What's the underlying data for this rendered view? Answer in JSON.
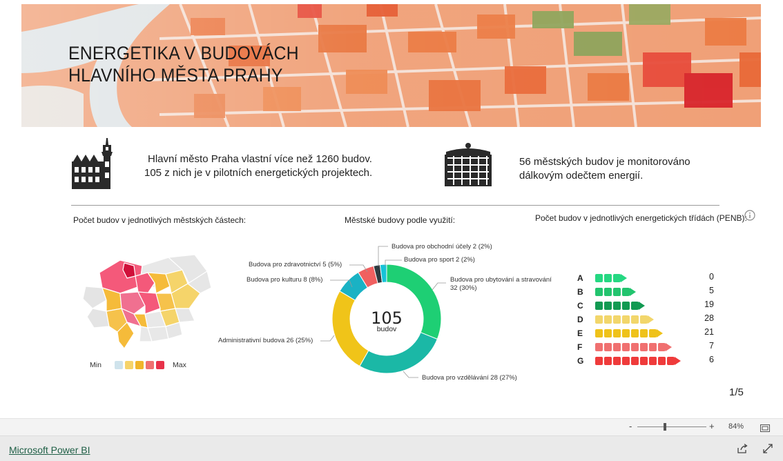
{
  "header": {
    "title_line1": "ENERGETIKA V BUDOVÁCH",
    "title_line2": "HLAVNÍHO MĚSTA PRAHY"
  },
  "info": {
    "left_line1": "Hlavní město Praha vlastní více než 1260 budov.",
    "left_line2": "105 z nich je v pilotních energetických projektech.",
    "right_line1": "56 městských budov je monitorováno",
    "right_line2": "dálkovým odečtem energií."
  },
  "sections": {
    "districts_label": "Počet budov v jednotlivých městských částech:",
    "usage_label": "Městské budovy podle využití:",
    "classes_label": "Počet budov v jednotlivých energetických třídách (PENB):"
  },
  "map_legend": {
    "min": "Min",
    "max": "Max",
    "colors": [
      "#cfe3ec",
      "#f6d36a",
      "#f0b52a",
      "#f07070",
      "#e8324a"
    ]
  },
  "donut": {
    "total": "105",
    "unit": "budov",
    "labels": {
      "sport": "Budova pro sport 2 (2%)",
      "obchod": "Budova pro obchodní účely 2 (2%)",
      "zdrav": "Budova pro zdravotnictví 5 (5%)",
      "kultura": "Budova pro kulturu 8 (8%)",
      "admin": "Administrativní budova 26 (25%)",
      "vzdel": "Budova pro vzdělávání 28 (27%)",
      "ubyt1": "Budova pro ubytování a stravování",
      "ubyt2": "32 (30%)"
    }
  },
  "chart_data": {
    "type": "pie",
    "title": "Městské budovy podle využití:",
    "center_label": "105 budov",
    "slices": [
      {
        "label": "Budova pro ubytování a stravování",
        "value": 32,
        "percent": 30,
        "color": "#1ecf74"
      },
      {
        "label": "Budova pro vzdělávání",
        "value": 28,
        "percent": 27,
        "color": "#1bb8a6"
      },
      {
        "label": "Administrativní budova",
        "value": 26,
        "percent": 25,
        "color": "#f0c419"
      },
      {
        "label": "Budova pro kulturu",
        "value": 8,
        "percent": 8,
        "color": "#1ab2c4"
      },
      {
        "label": "Budova pro zdravotnictví",
        "value": 5,
        "percent": 5,
        "color": "#f06060"
      },
      {
        "label": "Budova pro obchodní účely",
        "value": 2,
        "percent": 2,
        "color": "#2f3b40"
      },
      {
        "label": "Budova pro sport",
        "value": 2,
        "percent": 2,
        "color": "#17c3d8"
      }
    ]
  },
  "energy_classes": [
    {
      "letter": "A",
      "count": "0",
      "blocks": 3,
      "color": "#25d882"
    },
    {
      "letter": "B",
      "count": "5",
      "blocks": 4,
      "color": "#22c46e"
    },
    {
      "letter": "C",
      "count": "19",
      "blocks": 5,
      "color": "#129a52"
    },
    {
      "letter": "D",
      "count": "28",
      "blocks": 6,
      "color": "#f2d66b"
    },
    {
      "letter": "E",
      "count": "21",
      "blocks": 7,
      "color": "#efc21a"
    },
    {
      "letter": "F",
      "count": "7",
      "blocks": 8,
      "color": "#f07070"
    },
    {
      "letter": "G",
      "count": "6",
      "blocks": 9,
      "color": "#ef3b3b"
    }
  ],
  "page_indicator": "1/5",
  "statusbar": {
    "zoom_minus": "-",
    "zoom_plus": "+",
    "zoom_level": "84%"
  },
  "footer": {
    "brand": "Microsoft Power BI"
  },
  "icons": {
    "info": "info-icon",
    "town_hall": "town-hall-icon",
    "office_building": "office-building-icon",
    "fit_page": "fit-page-icon",
    "share": "share-icon",
    "fullscreen": "fullscreen-icon"
  }
}
